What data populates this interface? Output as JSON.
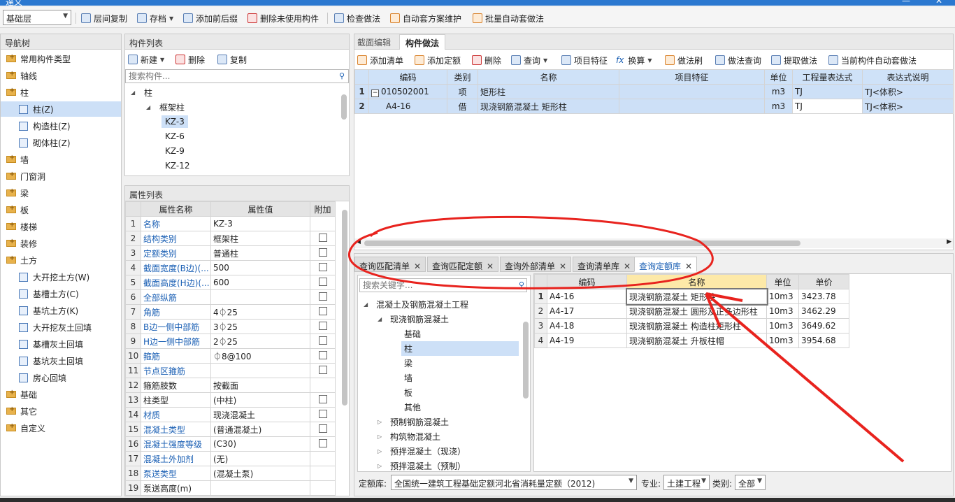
{
  "window": {
    "title": "達义",
    "controls": [
      "—",
      "✕"
    ]
  },
  "toolbar": {
    "floor_select": "基础层",
    "items": [
      {
        "label": "层间复制",
        "icon": "copy-floor-icon"
      },
      {
        "label": "存档",
        "icon": "save-icon",
        "caret": true
      },
      {
        "label": "添加前后缀",
        "icon": "add-prefix-icon"
      },
      {
        "label": "删除未使用构件",
        "icon": "delete-unused-icon"
      },
      {
        "label": "检查做法",
        "icon": "check-method-icon"
      },
      {
        "label": "自动套方案维护",
        "icon": "auto-scheme-icon"
      },
      {
        "label": "批量自动套做法",
        "icon": "batch-auto-icon"
      }
    ]
  },
  "nav": {
    "title": "导航树",
    "items": [
      {
        "label": "常用构件类型",
        "level": 0
      },
      {
        "label": "轴线",
        "level": 0
      },
      {
        "label": "柱",
        "level": 0,
        "open": true
      },
      {
        "label": "柱(Z)",
        "level": 1,
        "selected": true
      },
      {
        "label": "构造柱(Z)",
        "level": 1
      },
      {
        "label": "砌体柱(Z)",
        "level": 1
      },
      {
        "label": "墙",
        "level": 0
      },
      {
        "label": "门窗洞",
        "level": 0
      },
      {
        "label": "梁",
        "level": 0
      },
      {
        "label": "板",
        "level": 0
      },
      {
        "label": "楼梯",
        "level": 0
      },
      {
        "label": "装修",
        "level": 0
      },
      {
        "label": "土方",
        "level": 0,
        "open": true
      },
      {
        "label": "大开挖土方(W)",
        "level": 1
      },
      {
        "label": "基槽土方(C)",
        "level": 1
      },
      {
        "label": "基坑土方(K)",
        "level": 1
      },
      {
        "label": "大开挖灰土回填",
        "level": 1
      },
      {
        "label": "基槽灰土回填",
        "level": 1
      },
      {
        "label": "基坑灰土回填",
        "level": 1
      },
      {
        "label": "房心回填",
        "level": 1
      },
      {
        "label": "基础",
        "level": 0
      },
      {
        "label": "其它",
        "level": 0
      },
      {
        "label": "自定义",
        "level": 0
      }
    ]
  },
  "components": {
    "title": "构件列表",
    "new_label": "新建",
    "delete_label": "删除",
    "copy_label": "复制",
    "search_placeholder": "搜索构件...",
    "tree": [
      {
        "label": "柱",
        "level": 0
      },
      {
        "label": "框架柱",
        "level": 1
      },
      {
        "label": "KZ-3",
        "level": 2,
        "selected": true
      },
      {
        "label": "KZ-6",
        "level": 2
      },
      {
        "label": "KZ-9",
        "level": 2
      },
      {
        "label": "KZ-12",
        "level": 2
      }
    ]
  },
  "properties": {
    "title": "属性列表",
    "headers": [
      "属性名称",
      "属性值",
      "附加"
    ],
    "rows": [
      {
        "n": "1",
        "name": "名称",
        "value": "KZ-3",
        "link": true,
        "check": false
      },
      {
        "n": "2",
        "name": "结构类别",
        "value": "框架柱",
        "link": true,
        "check": true
      },
      {
        "n": "3",
        "name": "定额类别",
        "value": "普通柱",
        "link": true,
        "check": true
      },
      {
        "n": "4",
        "name": "截面宽度(B边)(...",
        "value": "500",
        "link": true,
        "check": true
      },
      {
        "n": "5",
        "name": "截面高度(H边)(...",
        "value": "600",
        "link": true,
        "check": true
      },
      {
        "n": "6",
        "name": "全部纵筋",
        "value": "",
        "link": true,
        "check": true
      },
      {
        "n": "7",
        "name": "角筋",
        "value": "4⏀25",
        "link": true,
        "check": true
      },
      {
        "n": "8",
        "name": "B边一侧中部筋",
        "value": "3⏀25",
        "link": true,
        "check": true
      },
      {
        "n": "9",
        "name": "H边一侧中部筋",
        "value": "2⏀25",
        "link": true,
        "check": true
      },
      {
        "n": "10",
        "name": "箍筋",
        "value": "⏀8@100",
        "link": true,
        "check": true
      },
      {
        "n": "11",
        "name": "节点区箍筋",
        "value": "",
        "link": true,
        "check": true
      },
      {
        "n": "12",
        "name": "箍筋肢数",
        "value": "按截面",
        "link": false,
        "check": false
      },
      {
        "n": "13",
        "name": "柱类型",
        "value": "(中柱)",
        "link": false,
        "check": true
      },
      {
        "n": "14",
        "name": "材质",
        "value": "现浇混凝土",
        "link": true,
        "check": true
      },
      {
        "n": "15",
        "name": "混凝土类型",
        "value": "(普通混凝土)",
        "link": true,
        "check": true
      },
      {
        "n": "16",
        "name": "混凝土强度等级",
        "value": "(C30)",
        "link": true,
        "check": true
      },
      {
        "n": "17",
        "name": "混凝土外加剂",
        "value": "(无)",
        "link": true,
        "check": false
      },
      {
        "n": "18",
        "name": "泵送类型",
        "value": "(混凝土泵)",
        "link": true,
        "check": false
      },
      {
        "n": "19",
        "name": "泵送高度(m)",
        "value": "",
        "link": false,
        "check": false
      }
    ]
  },
  "method": {
    "tabs": [
      "截面编辑",
      "构件做法"
    ],
    "active_tab": 1,
    "toolbar": [
      {
        "label": "添加清单",
        "icon": "add-list-icon"
      },
      {
        "label": "添加定额",
        "icon": "add-quota-icon"
      },
      {
        "label": "删除",
        "icon": "delete-icon"
      },
      {
        "label": "查询",
        "icon": "query-icon",
        "caret": true
      },
      {
        "label": "项目特征",
        "icon": "feature-icon"
      },
      {
        "label": "换算",
        "icon": "fx-icon",
        "caret": true
      },
      {
        "label": "做法刷",
        "icon": "brush-icon"
      },
      {
        "label": "做法查询",
        "icon": "method-query-icon"
      },
      {
        "label": "提取做法",
        "icon": "extract-icon"
      },
      {
        "label": "当前构件自动套做法",
        "icon": "auto-apply-icon"
      }
    ],
    "headers": [
      "编码",
      "类别",
      "名称",
      "项目特征",
      "单位",
      "工程量表达式",
      "表达式说明"
    ],
    "rows": [
      {
        "n": "1",
        "code": "010502001",
        "type": "项",
        "name": "矩形柱",
        "feature": "",
        "unit": "m3",
        "expr": "TJ",
        "desc": "TJ<体积>"
      },
      {
        "n": "2",
        "code": "A4-16",
        "type": "借",
        "name": "现浇钢筋混凝土 矩形柱",
        "feature": "",
        "unit": "m3",
        "expr": "TJ",
        "desc": "TJ<体积>"
      }
    ]
  },
  "query": {
    "tabs": [
      "查询匹配清单",
      "查询匹配定额",
      "查询外部清单",
      "查询清单库",
      "查询定额库"
    ],
    "active_tab": 4,
    "search_placeholder": "搜索关键字...",
    "tree": [
      {
        "label": "混凝土及钢筋混凝土工程",
        "level": 0,
        "open": true
      },
      {
        "label": "现浇钢筋混凝土",
        "level": 1,
        "open": true
      },
      {
        "label": "基础",
        "level": 2
      },
      {
        "label": "柱",
        "level": 2,
        "selected": true
      },
      {
        "label": "梁",
        "level": 2
      },
      {
        "label": "墙",
        "level": 2
      },
      {
        "label": "板",
        "level": 2
      },
      {
        "label": "其他",
        "level": 2
      },
      {
        "label": "预制钢筋混凝土",
        "level": 1
      },
      {
        "label": "构筑物混凝土",
        "level": 1
      },
      {
        "label": "预拌混凝土（现浇）",
        "level": 1
      },
      {
        "label": "预拌混凝土（预制）",
        "level": 1
      }
    ],
    "headers": [
      "编码",
      "名称",
      "单位",
      "单价"
    ],
    "rows": [
      {
        "n": "1",
        "code": "A4-16",
        "name": "现浇钢筋混凝土 矩形柱",
        "unit": "10m3",
        "price": "3423.78"
      },
      {
        "n": "2",
        "code": "A4-17",
        "name": "现浇钢筋混凝土 圆形及正多边形柱",
        "unit": "10m3",
        "price": "3462.29"
      },
      {
        "n": "3",
        "code": "A4-18",
        "name": "现浇钢筋混凝土 构造柱矩形柱",
        "unit": "10m3",
        "price": "3649.62"
      },
      {
        "n": "4",
        "code": "A4-19",
        "name": "现浇钢筋混凝土 升板柱帽",
        "unit": "10m3",
        "price": "3954.68"
      }
    ],
    "footer": {
      "quota_label": "定额库:",
      "quota_value": "全国统一建筑工程基础定额河北省消耗量定额（2012)",
      "major_label": "专业:",
      "major_value": "土建工程",
      "type_label": "类别:",
      "type_value": "全部"
    }
  },
  "annotation_color": "#e8231e"
}
